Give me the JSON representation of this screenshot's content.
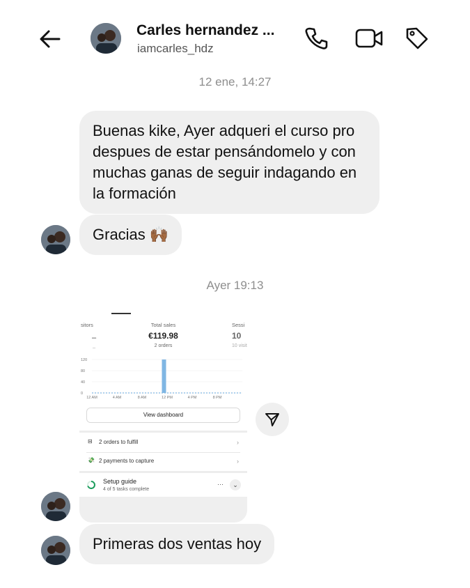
{
  "header": {
    "contact_name": "Carles hernandez ...",
    "contact_handle": "iamcarles_hdz",
    "back_icon": "arrow-left-icon",
    "call_icon": "phone-icon",
    "video_icon": "video-camera-icon",
    "tag_icon": "tag-icon"
  },
  "conversation": {
    "timestamp_1": "12 ene, 14:27",
    "message_1": "Buenas kike, Ayer adqueri el curso pro despues de estar pensándomelo y con muchas ganas de seguir indagando en la  formación",
    "message_2": "Gracias 🙌🏾",
    "timestamp_2": "Ayer 19:13",
    "message_3": "Primeras dos ventas hoy"
  },
  "shared_screenshot": {
    "kpi_left_label": "sitors",
    "kpi_left_value": "–",
    "kpi_left_sub": "–",
    "kpi_main_label": "Total sales",
    "kpi_main_value": "€119.98",
    "kpi_main_sub": "2 orders",
    "kpi_right_label": "Sessi",
    "kpi_right_value": "10",
    "kpi_right_sub": "10 visit",
    "view_dashboard": "View dashboard",
    "row_1": "2 orders to fulfill",
    "row_2": "2 payments to capture",
    "setup_title": "Setup guide",
    "setup_sub": "4 of 5 tasks complete",
    "more_label": "···",
    "chart_data": {
      "type": "bar",
      "title": "",
      "categories": [
        "12 AM",
        "4 AM",
        "8 AM",
        "12 PM",
        "4 PM",
        "8 PM"
      ],
      "x_ticks": [
        "12 AM",
        "4 AM",
        "8 AM",
        "12 PM",
        "4 PM",
        "8 PM"
      ],
      "y_ticks": [
        "0",
        "40",
        "80",
        "120"
      ],
      "ylim": [
        0,
        120
      ],
      "bar": {
        "x_hour": 11.5,
        "value": 120
      },
      "series_color": "#7fb6e3",
      "baseline_style": "dashed",
      "grid": true
    }
  },
  "share_icon": "paper-plane-icon",
  "colors": {
    "bubble": "#efefef",
    "timestamp": "#8e8e8e",
    "watermark": "#3cba54"
  }
}
